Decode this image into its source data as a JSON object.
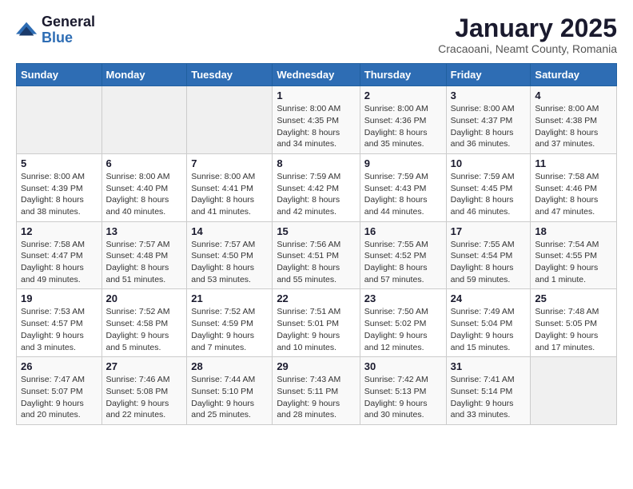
{
  "logo": {
    "general": "General",
    "blue": "Blue"
  },
  "header": {
    "title": "January 2025",
    "subtitle": "Cracaoani, Neamt County, Romania"
  },
  "days_of_week": [
    "Sunday",
    "Monday",
    "Tuesday",
    "Wednesday",
    "Thursday",
    "Friday",
    "Saturday"
  ],
  "weeks": [
    [
      null,
      null,
      null,
      {
        "day": 1,
        "sunrise": "8:00 AM",
        "sunset": "4:35 PM",
        "daylight": "8 hours and 34 minutes."
      },
      {
        "day": 2,
        "sunrise": "8:00 AM",
        "sunset": "4:36 PM",
        "daylight": "8 hours and 35 minutes."
      },
      {
        "day": 3,
        "sunrise": "8:00 AM",
        "sunset": "4:37 PM",
        "daylight": "8 hours and 36 minutes."
      },
      {
        "day": 4,
        "sunrise": "8:00 AM",
        "sunset": "4:38 PM",
        "daylight": "8 hours and 37 minutes."
      }
    ],
    [
      {
        "day": 5,
        "sunrise": "8:00 AM",
        "sunset": "4:39 PM",
        "daylight": "8 hours and 38 minutes."
      },
      {
        "day": 6,
        "sunrise": "8:00 AM",
        "sunset": "4:40 PM",
        "daylight": "8 hours and 40 minutes."
      },
      {
        "day": 7,
        "sunrise": "8:00 AM",
        "sunset": "4:41 PM",
        "daylight": "8 hours and 41 minutes."
      },
      {
        "day": 8,
        "sunrise": "7:59 AM",
        "sunset": "4:42 PM",
        "daylight": "8 hours and 42 minutes."
      },
      {
        "day": 9,
        "sunrise": "7:59 AM",
        "sunset": "4:43 PM",
        "daylight": "8 hours and 44 minutes."
      },
      {
        "day": 10,
        "sunrise": "7:59 AM",
        "sunset": "4:45 PM",
        "daylight": "8 hours and 46 minutes."
      },
      {
        "day": 11,
        "sunrise": "7:58 AM",
        "sunset": "4:46 PM",
        "daylight": "8 hours and 47 minutes."
      }
    ],
    [
      {
        "day": 12,
        "sunrise": "7:58 AM",
        "sunset": "4:47 PM",
        "daylight": "8 hours and 49 minutes."
      },
      {
        "day": 13,
        "sunrise": "7:57 AM",
        "sunset": "4:48 PM",
        "daylight": "8 hours and 51 minutes."
      },
      {
        "day": 14,
        "sunrise": "7:57 AM",
        "sunset": "4:50 PM",
        "daylight": "8 hours and 53 minutes."
      },
      {
        "day": 15,
        "sunrise": "7:56 AM",
        "sunset": "4:51 PM",
        "daylight": "8 hours and 55 minutes."
      },
      {
        "day": 16,
        "sunrise": "7:55 AM",
        "sunset": "4:52 PM",
        "daylight": "8 hours and 57 minutes."
      },
      {
        "day": 17,
        "sunrise": "7:55 AM",
        "sunset": "4:54 PM",
        "daylight": "8 hours and 59 minutes."
      },
      {
        "day": 18,
        "sunrise": "7:54 AM",
        "sunset": "4:55 PM",
        "daylight": "9 hours and 1 minute."
      }
    ],
    [
      {
        "day": 19,
        "sunrise": "7:53 AM",
        "sunset": "4:57 PM",
        "daylight": "9 hours and 3 minutes."
      },
      {
        "day": 20,
        "sunrise": "7:52 AM",
        "sunset": "4:58 PM",
        "daylight": "9 hours and 5 minutes."
      },
      {
        "day": 21,
        "sunrise": "7:52 AM",
        "sunset": "4:59 PM",
        "daylight": "9 hours and 7 minutes."
      },
      {
        "day": 22,
        "sunrise": "7:51 AM",
        "sunset": "5:01 PM",
        "daylight": "9 hours and 10 minutes."
      },
      {
        "day": 23,
        "sunrise": "7:50 AM",
        "sunset": "5:02 PM",
        "daylight": "9 hours and 12 minutes."
      },
      {
        "day": 24,
        "sunrise": "7:49 AM",
        "sunset": "5:04 PM",
        "daylight": "9 hours and 15 minutes."
      },
      {
        "day": 25,
        "sunrise": "7:48 AM",
        "sunset": "5:05 PM",
        "daylight": "9 hours and 17 minutes."
      }
    ],
    [
      {
        "day": 26,
        "sunrise": "7:47 AM",
        "sunset": "5:07 PM",
        "daylight": "9 hours and 20 minutes."
      },
      {
        "day": 27,
        "sunrise": "7:46 AM",
        "sunset": "5:08 PM",
        "daylight": "9 hours and 22 minutes."
      },
      {
        "day": 28,
        "sunrise": "7:44 AM",
        "sunset": "5:10 PM",
        "daylight": "9 hours and 25 minutes."
      },
      {
        "day": 29,
        "sunrise": "7:43 AM",
        "sunset": "5:11 PM",
        "daylight": "9 hours and 28 minutes."
      },
      {
        "day": 30,
        "sunrise": "7:42 AM",
        "sunset": "5:13 PM",
        "daylight": "9 hours and 30 minutes."
      },
      {
        "day": 31,
        "sunrise": "7:41 AM",
        "sunset": "5:14 PM",
        "daylight": "9 hours and 33 minutes."
      },
      null
    ]
  ]
}
